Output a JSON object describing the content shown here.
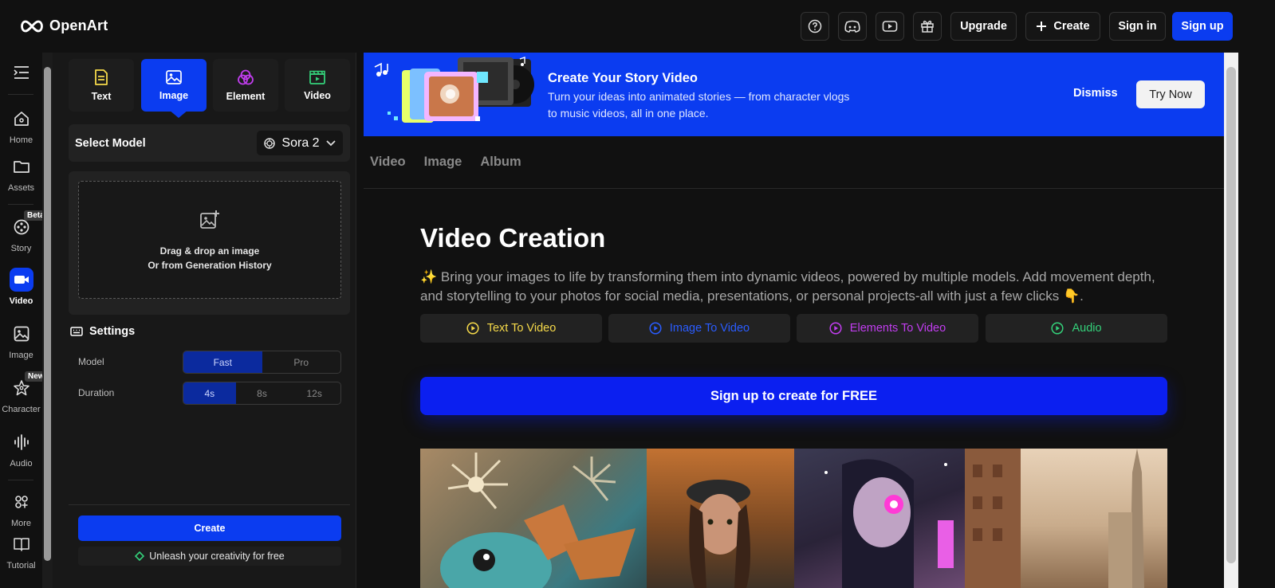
{
  "app": {
    "name": "OpenArt"
  },
  "header": {
    "upgrade_label": "Upgrade",
    "create_label": "Create",
    "signin_label": "Sign in",
    "signup_label": "Sign up",
    "icons": [
      "help-icon",
      "discord-icon",
      "youtube-icon",
      "gift-icon"
    ]
  },
  "rail": {
    "items": [
      {
        "label": "Home",
        "icon": "home-icon"
      },
      {
        "label": "Assets",
        "icon": "folder-icon"
      },
      {
        "label": "Story",
        "icon": "film-reel-icon",
        "badge": "Beta"
      },
      {
        "label": "Video",
        "icon": "video-camera-icon"
      },
      {
        "label": "Image",
        "icon": "image-icon"
      },
      {
        "label": "Character",
        "icon": "character-icon",
        "badge": "New"
      },
      {
        "label": "Audio",
        "icon": "audio-waveform-icon"
      },
      {
        "label": "More",
        "icon": "grid-icon"
      },
      {
        "label": "Tutorial",
        "icon": "book-icon"
      }
    ]
  },
  "panel": {
    "tabs": [
      {
        "label": "Text",
        "color": "#f5d94a"
      },
      {
        "label": "Image",
        "color": "#ffffff"
      },
      {
        "label": "Element",
        "color": "#c23df0"
      },
      {
        "label": "Video",
        "color": "#34d17a"
      }
    ],
    "select_model_label": "Select Model",
    "model_value": "Sora 2",
    "drop_line1": "Drag & drop an image",
    "drop_line2": "Or from Generation History",
    "settings_label": "Settings",
    "model_setting_label": "Model",
    "model_options": [
      "Fast",
      "Pro"
    ],
    "duration_label": "Duration",
    "duration_options": [
      "4s",
      "8s",
      "12s"
    ],
    "create_label": "Create",
    "free_note": "Unleash your creativity for free"
  },
  "banner": {
    "title": "Create Your Story Video",
    "desc": "Turn your ideas into animated stories — from character vlogs to music videos, all in one place.",
    "dismiss_label": "Dismiss",
    "try_label": "Try Now"
  },
  "main": {
    "tabs": [
      "Video",
      "Image",
      "Album"
    ],
    "title": "Video Creation",
    "desc": "✨ Bring your images to life by transforming them into dynamic videos, powered by multiple models. Add movement depth, and storytelling to your photos for social media, presentations, or personal projects-all with just a few clicks 👇.",
    "features": [
      {
        "label": "Text To Video",
        "color": "#f5d94a"
      },
      {
        "label": "Image To Video",
        "color": "#2a5cff"
      },
      {
        "label": "Elements To Video",
        "color": "#c23df0"
      },
      {
        "label": "Audio",
        "color": "#34d17a"
      }
    ],
    "cta_label": "Sign up to create for FREE"
  },
  "colors": {
    "accent": "#0b3cf0",
    "background": "#111111",
    "panel": "#181818"
  }
}
